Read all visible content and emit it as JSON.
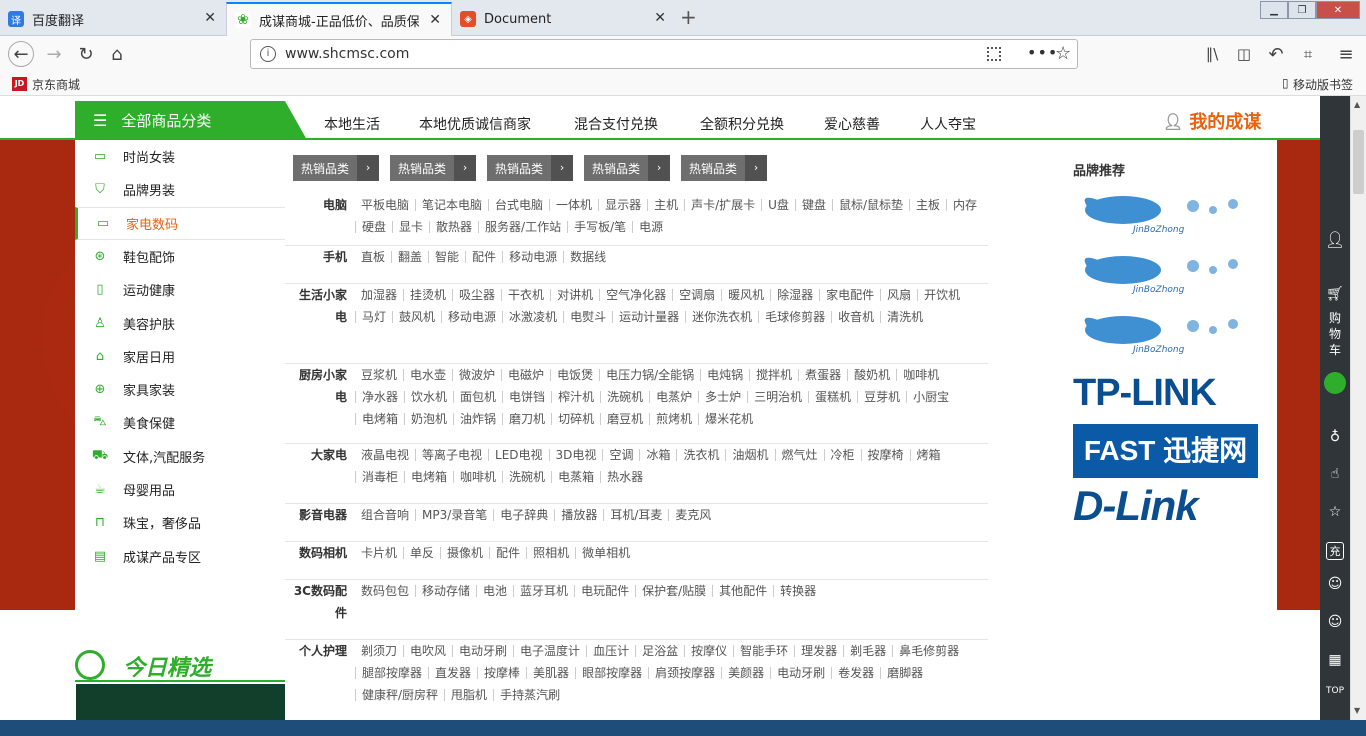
{
  "browser": {
    "tabs": [
      {
        "label": "百度翻译",
        "icon": "translate-icon"
      },
      {
        "label": "成谋商城-正品低价、品质保障",
        "icon": "shop-icon"
      },
      {
        "label": "Document",
        "icon": "document-icon"
      }
    ],
    "url": "www.shcmsc.com",
    "bookmarks": {
      "jd": "京东商城",
      "mobile": "移动版书签"
    }
  },
  "site": {
    "all_categories": "全部商品分类",
    "nav": [
      "本地生活",
      "本地优质诚信商家",
      "混合支付兑换",
      "全额积分兑换",
      "爱心慈善",
      "人人夺宝"
    ],
    "my_account": "我的成谋",
    "sidebar": [
      {
        "label": "时尚女装",
        "icon": "monitor-icon"
      },
      {
        "label": "品牌男装",
        "icon": "shirt-icon"
      },
      {
        "label": "家电数码",
        "icon": "laptop-icon"
      },
      {
        "label": "鞋包配饰",
        "icon": "bag-icon"
      },
      {
        "label": "运动健康",
        "icon": "phone-icon"
      },
      {
        "label": "美容护肤",
        "icon": "bottle-icon"
      },
      {
        "label": "家居日用",
        "icon": "home-icon"
      },
      {
        "label": "家具家装",
        "icon": "ball-icon"
      },
      {
        "label": "美食保健",
        "icon": "car-icon"
      },
      {
        "label": "文体,汽配服务",
        "icon": "cart-icon"
      },
      {
        "label": "母婴用品",
        "icon": "cup-icon"
      },
      {
        "label": "珠宝，奢侈品",
        "icon": "lock-icon"
      },
      {
        "label": "成谋产品专区",
        "icon": "box-icon"
      }
    ],
    "hot_tags": [
      "热销品类",
      "热销品类",
      "热销品类",
      "热销品类",
      "热销品类"
    ],
    "categories": [
      {
        "title": "电脑",
        "items": [
          "平板电脑",
          "笔记本电脑",
          "台式电脑",
          "一体机",
          "显示器",
          "主机",
          "声卡/扩展卡",
          "U盘",
          "键盘",
          "鼠标/鼠标垫",
          "主板",
          "内存",
          "硬盘",
          "显卡",
          "散热器",
          "服务器/工作站",
          "手写板/笔",
          "电源"
        ]
      },
      {
        "title": "手机",
        "items": [
          "直板",
          "翻盖",
          "智能",
          "配件",
          "移动电源",
          "数据线"
        ]
      },
      {
        "title": "生活小家电",
        "items": [
          "加湿器",
          "挂烫机",
          "吸尘器",
          "干衣机",
          "对讲机",
          "空气净化器",
          "空调扇",
          "暖风机",
          "除湿器",
          "家电配件",
          "风扇",
          "开饮机",
          "马灯",
          "鼓风机",
          "移动电源",
          "冰激凌机",
          "电熨斗",
          "运动计量器",
          "迷你洗衣机",
          "毛球修剪器",
          "收音机",
          "清洗机"
        ]
      },
      {
        "title": "厨房小家电",
        "items": [
          "豆浆机",
          "电水壶",
          "微波炉",
          "电磁炉",
          "电饭煲",
          "电压力锅/全能锅",
          "电炖锅",
          "搅拌机",
          "煮蛋器",
          "酸奶机",
          "咖啡机",
          "净水器",
          "饮水机",
          "面包机",
          "电饼铛",
          "榨汁机",
          "洗碗机",
          "电蒸炉",
          "多士炉",
          "三明治机",
          "蛋糕机",
          "豆芽机",
          "小厨宝",
          "电烤箱",
          "奶泡机",
          "油炸锅",
          "磨刀机",
          "切碎机",
          "磨豆机",
          "煎烤机",
          "爆米花机"
        ]
      },
      {
        "title": "大家电",
        "items": [
          "液晶电视",
          "等离子电视",
          "LED电视",
          "3D电视",
          "空调",
          "冰箱",
          "洗衣机",
          "油烟机",
          "燃气灶",
          "冷柜",
          "按摩椅",
          "烤箱",
          "消毒柜",
          "电烤箱",
          "咖啡机",
          "洗碗机",
          "电蒸箱",
          "热水器"
        ]
      },
      {
        "title": "影音电器",
        "items": [
          "组合音响",
          "MP3/录音笔",
          "电子辞典",
          "播放器",
          "耳机/耳麦",
          "麦克风"
        ]
      },
      {
        "title": "数码相机",
        "items": [
          "卡片机",
          "单反",
          "摄像机",
          "配件",
          "照相机",
          "微单相机"
        ]
      },
      {
        "title": "3C数码配件",
        "items": [
          "数码包包",
          "移动存储",
          "电池",
          "蓝牙耳机",
          "电玩配件",
          "保护套/贴膜",
          "其他配件",
          "转换器"
        ]
      },
      {
        "title": "个人护理",
        "items": [
          "剃须刀",
          "电吹风",
          "电动牙刷",
          "电子温度计",
          "血压计",
          "足浴盆",
          "按摩仪",
          "智能手环",
          "理发器",
          "剃毛器",
          "鼻毛修剪器",
          "腿部按摩器",
          "直发器",
          "按摩棒",
          "美肌器",
          "眼部按摩器",
          "肩颈按摩器",
          "美颜器",
          "电动牙刷",
          "卷发器",
          "磨脚器",
          "健康秤/厨房秤",
          "甩脂机",
          "手持蒸汽刷"
        ]
      }
    ],
    "brand_title": "品牌推荐",
    "brands": [
      "JinBoZhong",
      "JinBoZhong",
      "JinBoZhong",
      "TP-LINK",
      "FAST 迅捷网络",
      "D-Link"
    ],
    "today": "今日精选",
    "right_bar": {
      "cart": "购物车",
      "charge": "充",
      "top": "TOP"
    }
  },
  "colors": {
    "green": "#2eae2a",
    "orange": "#e8620e",
    "red_bg": "#b73016",
    "blue": "#0a4e8f"
  }
}
